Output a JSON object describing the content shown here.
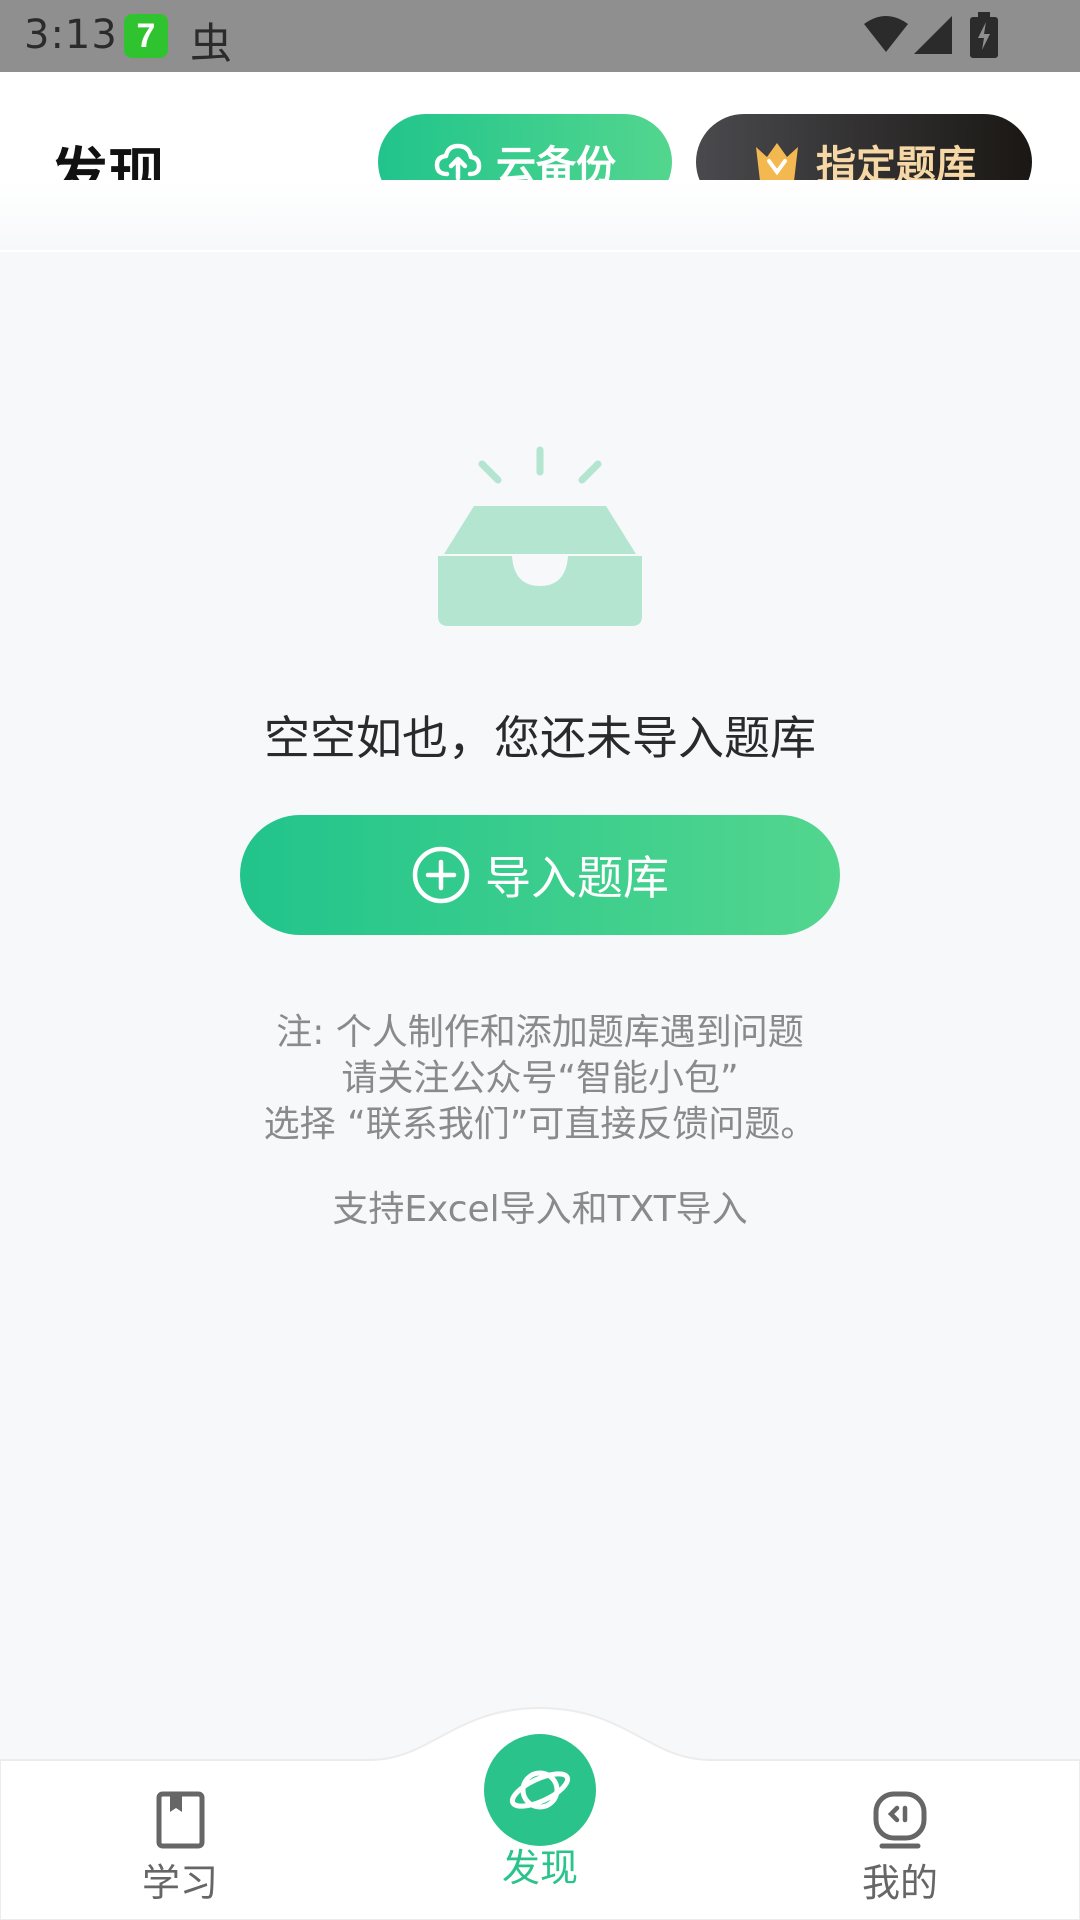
{
  "status_bar": {
    "time": "3:13",
    "app_badge": "7",
    "app_glyph": "虫"
  },
  "header": {
    "title": "发现",
    "cloud_backup_label": "云备份",
    "designated_bank_label": "指定题库"
  },
  "empty_state": {
    "message": "空空如也，您还未导入题库",
    "import_button_label": "导入题库",
    "note_line1": "注: 个人制作和添加题库遇到问题",
    "note_line2": "请关注公众号“智能小包”",
    "note_line3": "选择 “联系我们”可直接反馈问题。",
    "support_text": "支持Excel导入和TXT导入"
  },
  "bottom_nav": {
    "items": [
      {
        "label": "学习",
        "icon": "book-icon",
        "active": false
      },
      {
        "label": "发现",
        "icon": "planet-icon",
        "active": true
      },
      {
        "label": "我的",
        "icon": "face-icon",
        "active": false
      }
    ]
  },
  "colors": {
    "accent_green": "#2bc38c",
    "vip_gold": "#f6d8a6",
    "vip_dark": "#1a1714"
  }
}
